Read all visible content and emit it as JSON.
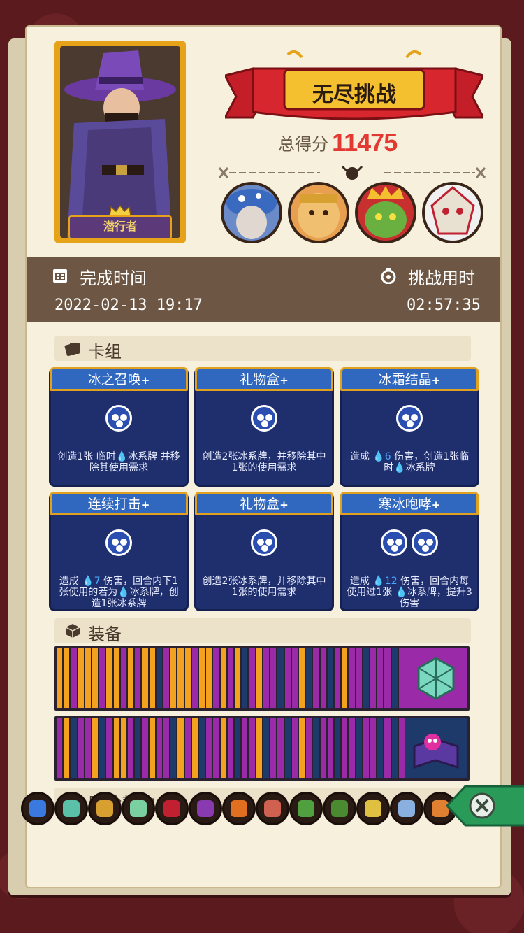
{
  "header": {
    "character_label": "潜行者",
    "mode_title": "无尽挑战",
    "score_label": "总得分",
    "score_value": "11475"
  },
  "stats": {
    "finish_time_label": "完成时间",
    "finish_time_value": "2022-02-13 19:17",
    "duration_label": "挑战用时",
    "duration_value": "02:57:35"
  },
  "sections": {
    "deck": "卡组",
    "equipment": "装备",
    "contract": "冒险契约"
  },
  "cards": [
    {
      "name": "冰之召唤",
      "plus": "+",
      "orbs": 1,
      "desc_parts": [
        "创造1张 临时",
        "💧",
        "冰系牌 并移除其使用需求"
      ]
    },
    {
      "name": "礼物盒",
      "plus": "+",
      "orbs": 1,
      "desc_parts": [
        "创造2张冰系牌，并移除其中1张的使用需求"
      ]
    },
    {
      "name": "冰霜结晶",
      "plus": "+",
      "orbs": 1,
      "desc_parts": [
        "造成 ",
        "💧6",
        " 伤害，创造1张临时",
        "💧",
        "冰系牌"
      ]
    },
    {
      "name": "连续打击",
      "plus": "+",
      "orbs": 1,
      "desc_parts": [
        "造成 ",
        "💧7",
        " 伤害，回合内下1张使用的若为",
        "💧",
        "冰系牌，创造1张冰系牌"
      ]
    },
    {
      "name": "礼物盒",
      "plus": "+",
      "orbs": 1,
      "desc_parts": [
        "创造2张冰系牌，并移除其中1张的使用需求"
      ]
    },
    {
      "name": "寒冰咆哮",
      "plus": "+",
      "orbs": 2,
      "desc_parts": [
        "造成 ",
        "💧12",
        " 伤害，回合内每使用过1张 ",
        "💧",
        "冰系牌，提升3伤害"
      ]
    }
  ],
  "colors": {
    "orange": "#f2a21e",
    "purple": "#9a2aa8",
    "navy": "#1e3a6a",
    "card_bg": "#1f2f6e",
    "card_title": "#3068c0",
    "score_red": "#e23a32"
  },
  "equipment_rows": [
    {
      "pattern": [
        "o",
        "o",
        "p",
        "o",
        "o",
        "o",
        "p",
        "o",
        "o",
        "p",
        "o",
        "p",
        "o",
        "o",
        "n",
        "p",
        "o",
        "o",
        "o",
        "p",
        "o",
        "o",
        "p",
        "o",
        "p",
        "o",
        "n",
        "p",
        "o",
        "p",
        "p",
        "n",
        "p",
        "p",
        "o",
        "n",
        "p",
        "p",
        "n",
        "p",
        "o",
        "p",
        "p",
        "n",
        "p",
        "p",
        "p",
        "n",
        "p",
        "p"
      ],
      "end_icon": "d20-dice-icon",
      "end_color": "#9a2aa8"
    },
    {
      "pattern": [
        "p",
        "o",
        "n",
        "p",
        "p",
        "o",
        "n",
        "p",
        "o",
        "o",
        "p",
        "n",
        "p",
        "o",
        "p",
        "p",
        "n",
        "o",
        "p",
        "o",
        "n",
        "p",
        "p",
        "o",
        "p",
        "n",
        "p",
        "p",
        "o",
        "n",
        "p",
        "p",
        "n",
        "p",
        "o",
        "p",
        "n",
        "p",
        "p",
        "n",
        "p",
        "p",
        "n",
        "p",
        "p",
        "n",
        "p",
        "n",
        "p",
        "n"
      ],
      "end_icon": "skull-book-icon",
      "end_color": "#1e3a6a"
    }
  ],
  "contracts": [
    {
      "icon": "blue-flame-skull-icon",
      "color": "#3a7ae0"
    },
    {
      "icon": "teal-potion-icon",
      "color": "#5ac0a8"
    },
    {
      "icon": "scroll-icon",
      "color": "#d8a030"
    },
    {
      "icon": "green-bottle-icon",
      "color": "#7ad0a0"
    },
    {
      "icon": "heart-book-icon",
      "color": "#c02030"
    },
    {
      "icon": "purple-bat-icon",
      "color": "#8a3ab0"
    },
    {
      "icon": "fire-burst-icon",
      "color": "#e07020"
    },
    {
      "icon": "meat-icon",
      "color": "#d06050"
    },
    {
      "icon": "green-creature-icon",
      "color": "#50a040"
    },
    {
      "icon": "star-leaf-icon",
      "color": "#4a8a30"
    },
    {
      "icon": "flower-pot-icon",
      "color": "#e0c040"
    },
    {
      "icon": "ice-scroll-icon",
      "color": "#8ab0e0"
    },
    {
      "icon": "fire-bowl-icon",
      "color": "#e08030"
    }
  ]
}
